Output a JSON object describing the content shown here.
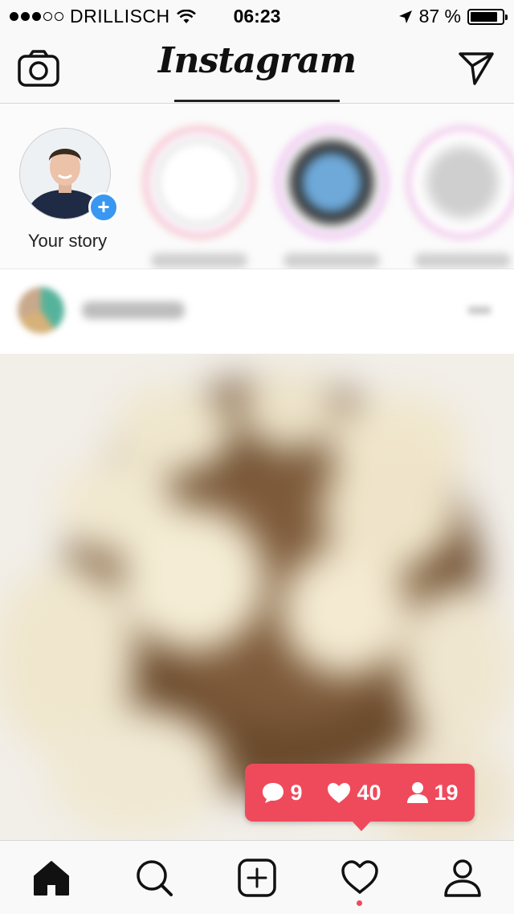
{
  "status_bar": {
    "signal_dots_filled": 3,
    "signal_dots_total": 5,
    "carrier": "DRILLISCH",
    "time": "06:23",
    "battery_percent_label": "87 %",
    "battery_level": 0.87,
    "icons": [
      "wifi-icon",
      "location-arrow-icon",
      "battery-icon"
    ]
  },
  "header": {
    "logo_text": "Instagram",
    "left_icon": "camera-icon",
    "right_icon": "direct-send-icon"
  },
  "stories": {
    "own_label": "Your story",
    "add_icon": "plus-icon",
    "ring_colors": [
      "#f2a6d6",
      "#f9c98f"
    ],
    "accent": "#3897f0"
  },
  "activity_popup": {
    "comments": "9",
    "likes": "40",
    "followers": "19",
    "icons": [
      "comment-icon",
      "heart-icon",
      "person-icon"
    ],
    "color": "#ef4a5b"
  },
  "bottom_nav": {
    "items": [
      "home-icon",
      "search-icon",
      "new-post-icon",
      "activity-heart-icon",
      "profile-icon"
    ],
    "active": "home-icon"
  }
}
